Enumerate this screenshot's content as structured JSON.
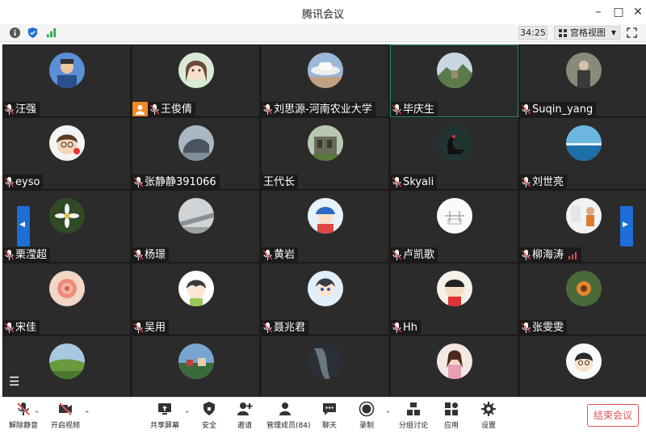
{
  "window": {
    "title": "腾讯会议"
  },
  "toolbar": {
    "timer": "34:25",
    "view_label": "宫格视图"
  },
  "participants": [
    {
      "name": "汪强",
      "host": false,
      "avatar": "cartoon-man-icon"
    },
    {
      "name": "王俊倩",
      "host": true,
      "avatar": "cartoon-girl-icon"
    },
    {
      "name": "刘思源-河南农业大学",
      "host": false,
      "avatar": "hat-photo-icon"
    },
    {
      "name": "毕庆生",
      "host": false,
      "avatar": "landscape-photo-icon",
      "active": true
    },
    {
      "name": "Suqin_yang",
      "host": false,
      "avatar": "person-photo-icon"
    },
    {
      "name": "eyso",
      "host": false,
      "avatar": "cartoon-boy-icon"
    },
    {
      "name": "张静静391066",
      "host": false,
      "avatar": "rock-photo-icon"
    },
    {
      "name": "王代长",
      "host": false,
      "avatar": "ruins-photo-icon",
      "no_mic": true
    },
    {
      "name": "Skyali",
      "host": false,
      "avatar": "swan-photo-icon"
    },
    {
      "name": "刘世亮",
      "host": false,
      "avatar": "sea-photo-icon"
    },
    {
      "name": "栗滢超",
      "host": false,
      "avatar": "flower-photo-icon"
    },
    {
      "name": "杨璟",
      "host": false,
      "avatar": "road-photo-icon"
    },
    {
      "name": "黄岩",
      "host": false,
      "avatar": "cartoon-kid-icon"
    },
    {
      "name": "卢凯歌",
      "host": false,
      "avatar": "sketch-icon"
    },
    {
      "name": "柳海涛",
      "host": false,
      "avatar": "figure-photo-icon",
      "signal": true
    },
    {
      "name": "宋佳",
      "host": false,
      "avatar": "rose-photo-icon"
    },
    {
      "name": "吴用",
      "host": false,
      "avatar": "cartoon-girl2-icon"
    },
    {
      "name": "聂兆君",
      "host": false,
      "avatar": "cartoon-anime-icon"
    },
    {
      "name": "Hh",
      "host": false,
      "avatar": "crayon-icon"
    },
    {
      "name": "张雯雯",
      "host": false,
      "avatar": "flower2-photo-icon"
    },
    {
      "name": "",
      "host": false,
      "avatar": "field-photo-icon"
    },
    {
      "name": "",
      "host": false,
      "avatar": "town-photo-icon"
    },
    {
      "name": "",
      "host": false,
      "avatar": "dark-photo-icon"
    },
    {
      "name": "",
      "host": false,
      "avatar": "girl-photo-icon"
    },
    {
      "name": "",
      "host": false,
      "avatar": "cartoon-boy2-icon"
    }
  ],
  "bottom_bar": {
    "unmute": "解除静音",
    "start_video": "开启视频",
    "share_screen": "共享屏幕",
    "security": "安全",
    "invite": "邀请",
    "manage_members": "管理成员(84)",
    "chat": "聊天",
    "record": "录制",
    "breakout": "分组讨论",
    "apps": "应用",
    "settings": "设置",
    "end_meeting": "结束会议"
  },
  "colors": {
    "accent": "#1e6ed8",
    "host": "#f08a24",
    "end": "#e25555",
    "active_border": "#2e8b57"
  }
}
